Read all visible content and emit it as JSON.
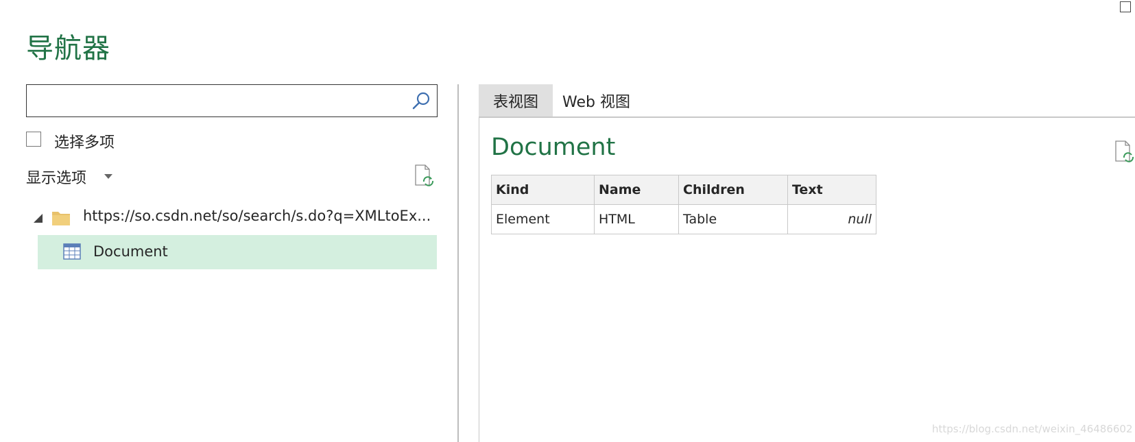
{
  "window": {
    "title": "导航器",
    "maximize_icon": "maximize-icon"
  },
  "search": {
    "value": "",
    "placeholder": "",
    "icon": "search-icon"
  },
  "select_multiple": {
    "label": "选择多项",
    "checked": false
  },
  "display_options": {
    "label": "显示选项",
    "icon": "caret-down-icon"
  },
  "refresh_icon": "refresh-file-icon",
  "tree": {
    "root": {
      "label": "https://so.csdn.net/so/search/s.do?q=XMLtoEx...",
      "icon": "folder-icon",
      "expanded": true
    },
    "children": [
      {
        "label": "Document",
        "icon": "table-icon",
        "selected": true
      }
    ]
  },
  "tabs": [
    {
      "label": "表视图",
      "active": true
    },
    {
      "label": "Web 视图",
      "active": false
    }
  ],
  "preview": {
    "title": "Document",
    "columns": [
      "Kind",
      "Name",
      "Children",
      "Text"
    ],
    "rows": [
      [
        "Element",
        "HTML",
        "Table",
        "null"
      ]
    ]
  },
  "watermark": "https://blog.csdn.net/weixin_46486602",
  "colors": {
    "accent": "#217346",
    "selection": "#d4efdf",
    "tab_active": "#e0e0e0"
  }
}
